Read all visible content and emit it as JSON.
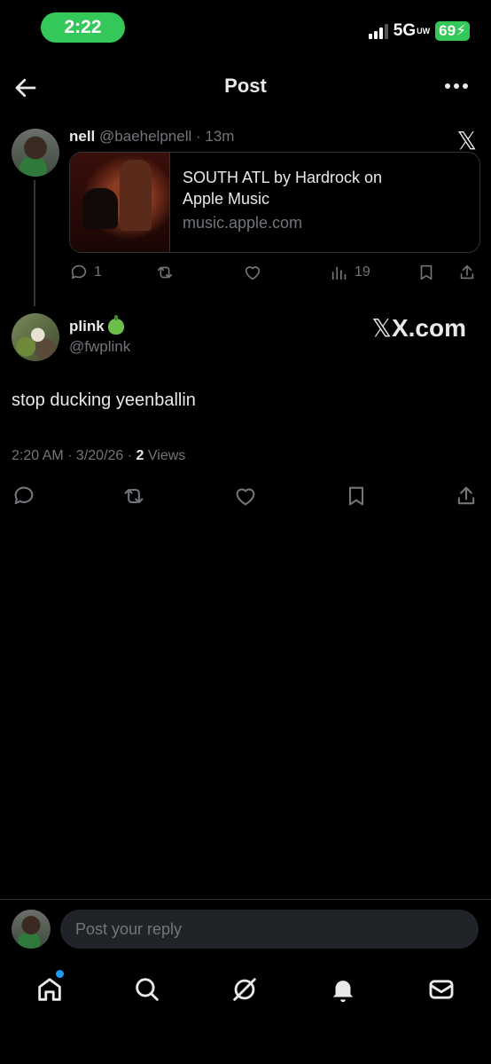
{
  "status": {
    "time": "2:22",
    "network": "5G",
    "network_sup": "UW",
    "battery": "69"
  },
  "header": {
    "title": "Post"
  },
  "parent_post": {
    "name": "nell",
    "handle": "@baehelpnell",
    "age": "13m",
    "card": {
      "title": "SOUTH ATL by Hardrock on Apple Music",
      "domain": "music.apple.com"
    },
    "replies": "1",
    "views": "19"
  },
  "main_post": {
    "name": "plink",
    "handle": "@fwplink",
    "watermark": "X.com",
    "text": "stop ducking yeenballin",
    "time": "2:20 AM",
    "date": "3/20/26",
    "views_count": "2",
    "views_label": "Views"
  },
  "reply_bar": {
    "placeholder": "Post your reply"
  },
  "colors": {
    "accent": "#1d9bf0",
    "status_green": "#34c759",
    "muted": "#71767b",
    "divider": "#2f3336"
  }
}
